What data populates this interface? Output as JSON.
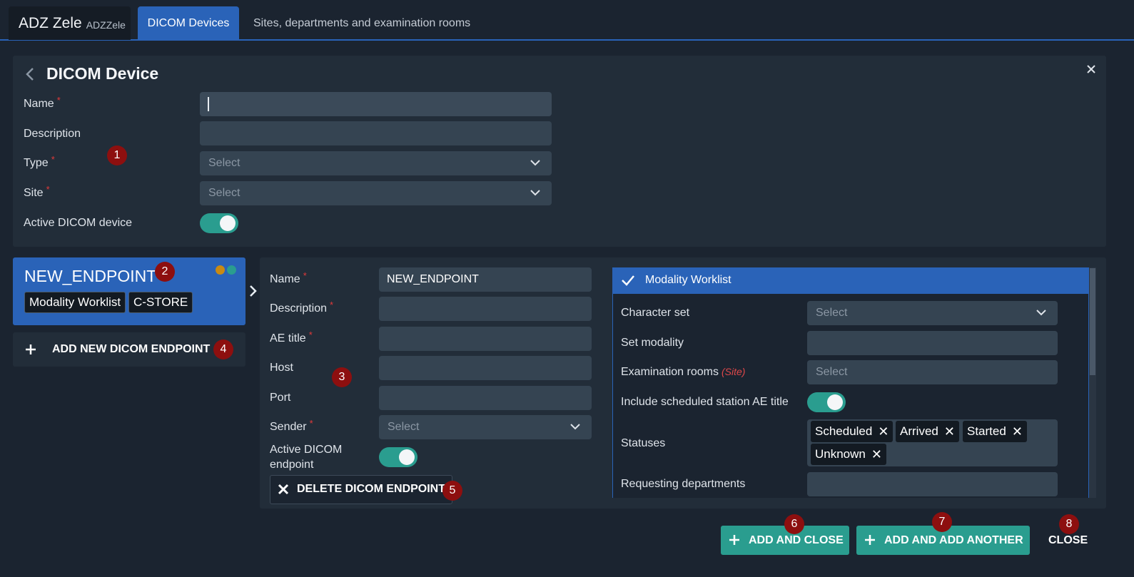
{
  "tabs": {
    "app_name": "ADZ Zele",
    "app_code": "ADZZele",
    "active": "DICOM Devices",
    "inactive": "Sites, departments and examination rooms"
  },
  "device": {
    "title": "DICOM Device",
    "name_label": "Name",
    "description_label": "Description",
    "type_label": "Type",
    "type_placeholder": "Select",
    "site_label": "Site",
    "site_placeholder": "Select",
    "active_label": "Active DICOM device",
    "active": true
  },
  "endpoint_card": {
    "title": "NEW_ENDPOINT",
    "chips": [
      "Modality Worklist",
      "C-STORE"
    ],
    "status_colors": [
      "#c98a12",
      "#2a9d8f"
    ]
  },
  "add_endpoint_label": "ADD NEW DICOM ENDPOINT",
  "endpoint_form": {
    "name_label": "Name",
    "name_value": "NEW_ENDPOINT",
    "description_label": "Description",
    "ae_title_label": "AE title",
    "host_label": "Host",
    "port_label": "Port",
    "sender_label": "Sender",
    "sender_placeholder": "Select",
    "active_label_1": "Active DICOM",
    "active_label_2": "endpoint",
    "active": true,
    "delete_label": "DELETE DICOM ENDPOINT"
  },
  "worklist": {
    "title": "Modality Worklist",
    "charset_label": "Character set",
    "charset_placeholder": "Select",
    "set_modality_label": "Set modality",
    "exam_rooms_label": "Examination rooms",
    "exam_rooms_note": "(Site)",
    "exam_rooms_placeholder": "Select",
    "include_ae_label": "Include scheduled station AE title",
    "include_ae": true,
    "statuses_label": "Statuses",
    "statuses": [
      "Scheduled",
      "Arrived",
      "Started",
      "Unknown"
    ],
    "requesting_label": "Requesting departments"
  },
  "footer": {
    "add_close": "ADD AND CLOSE",
    "add_another": "ADD AND ADD ANOTHER",
    "close": "CLOSE"
  },
  "badges": [
    "1",
    "2",
    "3",
    "4",
    "5",
    "6",
    "7",
    "8"
  ],
  "colors": {
    "accent_blue": "#2a63b8",
    "accent_teal": "#2a9d8f",
    "badge_red": "#8d0f0f",
    "required_red": "#e23a3a"
  }
}
